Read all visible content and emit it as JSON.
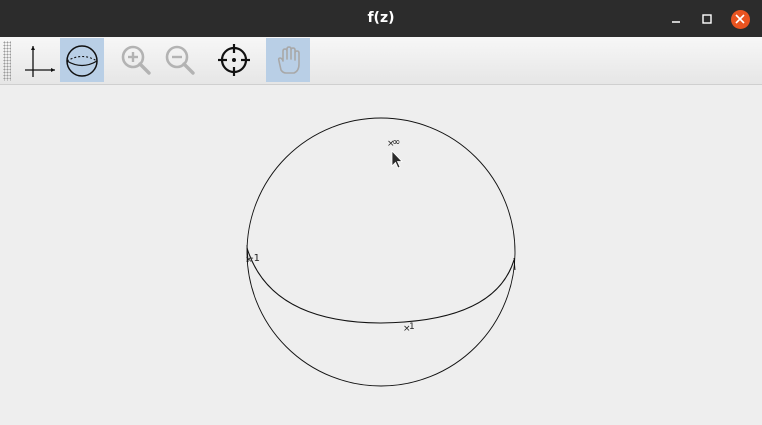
{
  "window": {
    "title": "f(z)"
  },
  "toolbar": {
    "tools": [
      {
        "name": "axes-view",
        "icon": "axes-icon",
        "active": false
      },
      {
        "name": "sphere-view",
        "icon": "riemann-sphere-icon",
        "active": true
      },
      {
        "name": "zoom-in",
        "icon": "zoom-in-icon",
        "active": false
      },
      {
        "name": "zoom-out",
        "icon": "zoom-out-icon",
        "active": false
      },
      {
        "name": "center",
        "icon": "crosshair-icon",
        "active": false
      },
      {
        "name": "pan",
        "icon": "hand-icon",
        "active": true
      }
    ]
  },
  "sphere": {
    "labels": {
      "infinity": "∞",
      "minus_one": "-1",
      "one": "1"
    }
  },
  "colors": {
    "titlebar": "#2c2c2c",
    "close": "#e95420",
    "active_tool": "#b9cfe6",
    "background": "#eeeeee"
  }
}
